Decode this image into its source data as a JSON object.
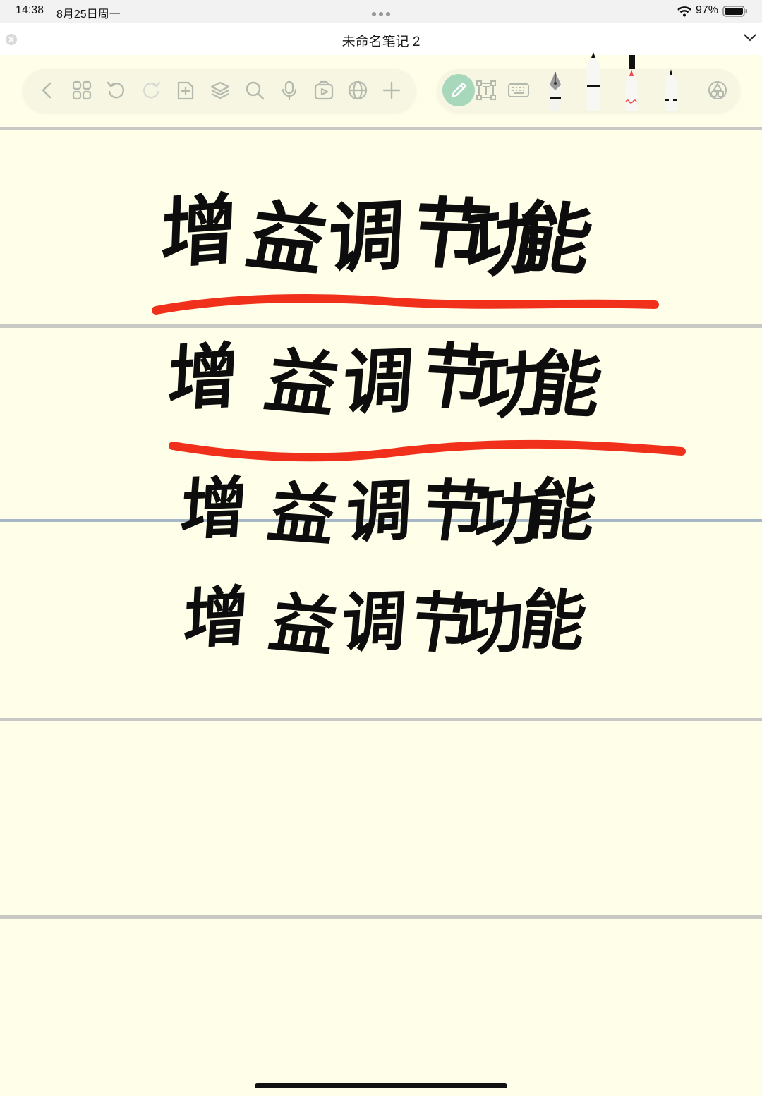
{
  "status_bar": {
    "time": "14:38",
    "date": "8月25日周一",
    "battery": "97%",
    "icons": [
      "multitask-dots-icon",
      "wifi-icon",
      "battery-icon"
    ]
  },
  "note": {
    "title": "未命名笔记 2"
  },
  "toolbar": {
    "left_icons": [
      "back-chevron-icon",
      "page-grid-icon",
      "undo-icon",
      "redo-icon",
      "add-page-icon",
      "layers-icon",
      "search-icon",
      "microphone-icon",
      "media-icon",
      "globe-icon",
      "plus-icon"
    ],
    "right_icons": [
      "pen-mode-icon",
      "text-box-icon",
      "keyboard-icon",
      "fountain-pen-icon",
      "ballpoint-pen-icon",
      "highlighter-pen-icon",
      "fine-pen-icon",
      "shapes-icon"
    ]
  },
  "colors": {
    "paper": "#fefee9",
    "ink": "#0d0d0d",
    "underline": "#f0301a",
    "active_tool": "#a8d8bc"
  },
  "handwriting": {
    "lines": [
      {
        "text": "增益调节功能",
        "underlined": true
      },
      {
        "text": "增益调节功能",
        "underlined": true
      },
      {
        "text": "增益调节功能",
        "underlined": false
      },
      {
        "text": "增益调节功能",
        "underlined": false
      }
    ]
  }
}
